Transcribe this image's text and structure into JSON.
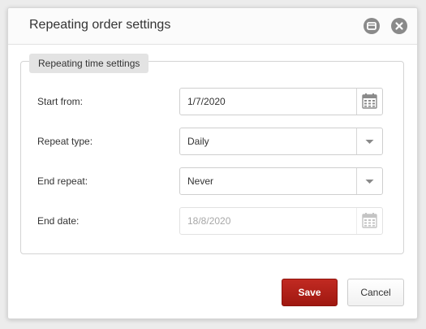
{
  "dialog": {
    "title": "Repeating order settings",
    "maximize_icon": "maximize-icon",
    "close_icon": "close-icon"
  },
  "section": {
    "legend": "Repeating time settings"
  },
  "fields": {
    "start_from": {
      "label": "Start from:",
      "value": "1/7/2020",
      "icon": "calendar-icon"
    },
    "repeat_type": {
      "label": "Repeat type:",
      "value": "Daily",
      "icon": "chevron-down-icon"
    },
    "end_repeat": {
      "label": "End repeat:",
      "value": "Never",
      "icon": "chevron-down-icon"
    },
    "end_date": {
      "label": "End date:",
      "value": "18/8/2020",
      "icon": "calendar-icon",
      "disabled": true
    }
  },
  "buttons": {
    "save_label": "Save",
    "cancel_label": "Cancel"
  },
  "colors": {
    "primary": "#b0201a",
    "icon_gray": "#8a8a8a"
  }
}
